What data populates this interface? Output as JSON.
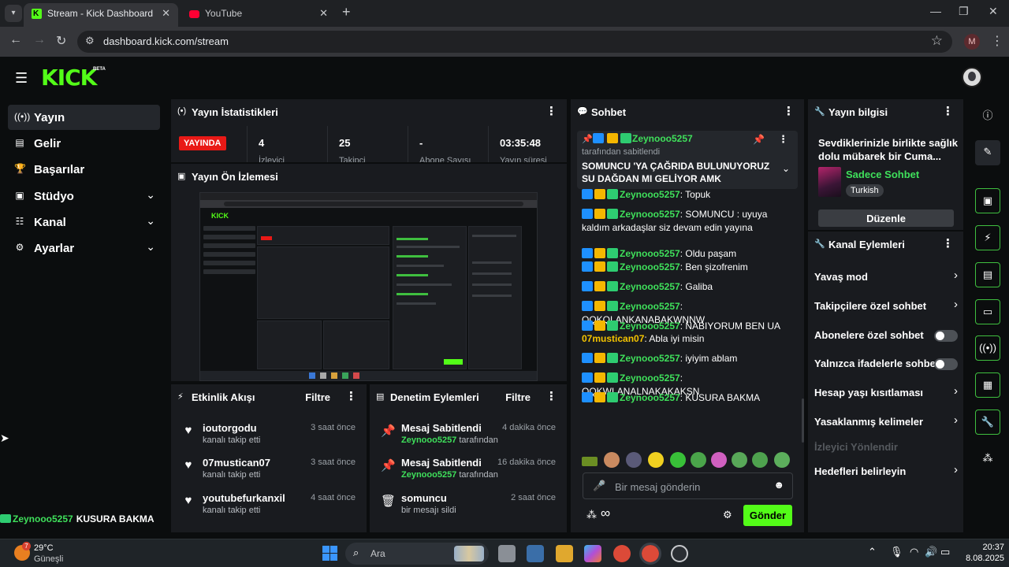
{
  "browser": {
    "tabs": [
      {
        "title": "Stream - Kick Dashboard",
        "active": true
      },
      {
        "title": "YouTube",
        "active": false
      }
    ],
    "url": "dashboard.kick.com/stream",
    "profile_initial": "M"
  },
  "header": {
    "logo": "KICK",
    "beta": "BETA"
  },
  "sidebar": {
    "items": [
      {
        "label": "Yayın",
        "icon": "broadcast-icon"
      },
      {
        "label": "Gelir",
        "icon": "chart-icon"
      },
      {
        "label": "Başarılar",
        "icon": "trophy-icon"
      },
      {
        "label": "Stüdyo",
        "icon": "studio-icon"
      },
      {
        "label": "Kanal",
        "icon": "channel-icon"
      },
      {
        "label": "Ayarlar",
        "icon": "gear-icon"
      }
    ]
  },
  "stats": {
    "title": "Yayın İstatistikleri",
    "live_badge": "YAYINDA",
    "cells": [
      {
        "value": "4",
        "label": "İzleyici"
      },
      {
        "value": "25",
        "label": "Takipçi"
      },
      {
        "value": "-",
        "label": "Abone Sayısı"
      },
      {
        "value": "03:35:48",
        "label": "Yayın süresi"
      }
    ]
  },
  "preview": {
    "title": "Yayın Ön İzlemesi"
  },
  "activity": {
    "title": "Etkinlik Akışı",
    "filter": "Filtre",
    "items": [
      {
        "name": "ioutorgodu",
        "sub": "kanalı takip etti",
        "time": "3 saat önce"
      },
      {
        "name": "07mustican07",
        "sub": "kanalı takip etti",
        "time": "3 saat önce"
      },
      {
        "name": "youtubefurkanxil",
        "sub": "kanalı takip etti",
        "time": "4 saat önce"
      }
    ]
  },
  "moderation": {
    "title": "Denetim Eylemleri",
    "filter": "Filtre",
    "items": [
      {
        "name": "Mesaj Sabitlendi",
        "user": "Zeynooo5257",
        "sub": "tarafından",
        "time": "4 dakika önce"
      },
      {
        "name": "Mesaj Sabitlendi",
        "user": "Zeynooo5257",
        "sub": "tarafından",
        "time": "16 dakika önce"
      },
      {
        "name": "somuncu",
        "user": "",
        "sub": "bir mesajı sildi",
        "time": "2 saat önce"
      }
    ]
  },
  "chat": {
    "title": "Sohbet",
    "pinned": {
      "user": "Zeynooo5257",
      "by": "tarafından sabitlendi",
      "text": "SOMUNCU 'YA ÇAĞRIDA BULUNUYORUZ SU DAĞDAN MI GELİYOR AMK"
    },
    "messages": [
      {
        "user": "Zeynooo5257",
        "text": "Topuk"
      },
      {
        "user": "Zeynooo5257",
        "text": "SOMUNCU : uyuya kaldım arkadaşlar siz devam edin yayına"
      },
      {
        "user": "Zeynooo5257",
        "text": "Oldu paşam"
      },
      {
        "user": "Zeynooo5257",
        "text": "Ben şizofrenim"
      },
      {
        "user": "Zeynooo5257",
        "text": "Galiba"
      },
      {
        "user": "Zeynooo5257",
        "text": "OQKQLANKANABAKWNNW"
      },
      {
        "user": "Zeynooo5257",
        "text": "NABIYORUM BEN UA"
      },
      {
        "user": "07mustican07",
        "text": "Abla iyi misin"
      },
      {
        "user": "Zeynooo5257",
        "text": "iyiyim ablam"
      },
      {
        "user": "Zeynooo5257",
        "text": "OQKWLANALNAKAKAKSN"
      },
      {
        "user": "Zeynooo5257",
        "text": "KUSURA BAKMA"
      }
    ],
    "input_placeholder": "Bir mesaj gönderin",
    "send_label": "Gönder",
    "infinity": "∞"
  },
  "stream_info": {
    "title": "Yayın bilgisi",
    "stream_title": "Sevdiklerinizle birlikte sağlık dolu mübarek bir Cuma...",
    "category": "Sadece Sohbet",
    "tag": "Turkish",
    "edit_label": "Düzenle"
  },
  "channel_actions": {
    "title": "Kanal Eylemleri",
    "items": [
      {
        "label": "Yavaş mod",
        "kind": "arrow"
      },
      {
        "label": "Takipçilere özel sohbet",
        "kind": "arrow"
      },
      {
        "label": "Abonelere özel sohbet",
        "kind": "toggle",
        "on": false
      },
      {
        "label": "Yalnızca ifadelerle sohbet",
        "kind": "toggle",
        "on": false
      },
      {
        "label": "Hesap yaşı kısıtlaması",
        "kind": "arrow"
      },
      {
        "label": "Yasaklanmış kelimeler",
        "kind": "arrow"
      },
      {
        "label": "İzleyici Yönlendir",
        "kind": "disabled"
      },
      {
        "label": "Hedefleri belirleyin",
        "kind": "arrow"
      }
    ]
  },
  "ticker": {
    "user": "Zeynooo5257",
    "text": "KUSURA BAKMA"
  },
  "taskbar": {
    "temp": "29°C",
    "condition": "Güneşli",
    "weather_badge": "7",
    "search": "Ara",
    "time": "20:37",
    "date": "8.08.2025"
  },
  "colors": {
    "accent": "#53fc18",
    "live": "#e91916",
    "username": "#3fe05b",
    "username_alt": "#f5c400"
  }
}
